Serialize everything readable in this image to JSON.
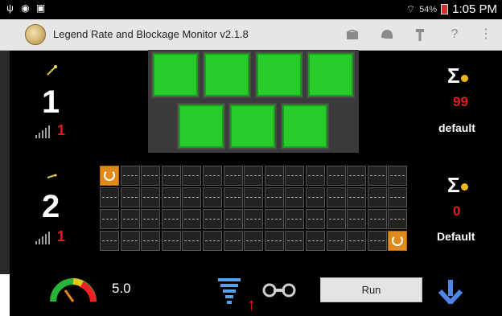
{
  "status_bar": {
    "left_icons": [
      "usb-icon",
      "location-icon",
      "image-icon"
    ],
    "wifi_icon": "wifi-icon",
    "battery_text": "54%",
    "time": "1:05 PM"
  },
  "app_bar": {
    "title": "Legend Rate and Blockage Monitor v2.1.8",
    "actions": [
      "seed-tray-icon",
      "helmet-icon",
      "tool-icon",
      "help-icon",
      "overflow-menu-icon"
    ]
  },
  "channels": [
    {
      "number": "1",
      "signal_value": "1",
      "sum_count": "99",
      "profile": "default"
    },
    {
      "number": "2",
      "signal_value": "1",
      "sum_count": "0",
      "profile": "Default"
    }
  ],
  "grid_channel1": {
    "rows": 2,
    "top_count": 4,
    "bottom_count": 3,
    "status_color": "#27cc2a"
  },
  "grid_channel2": {
    "rows": 4,
    "cols": 15,
    "highlighted": [
      [
        0,
        0
      ],
      [
        3,
        14
      ]
    ],
    "highlight_color": "#e08a1c"
  },
  "bottom": {
    "speed": "5.0",
    "run_label": "Run"
  },
  "colors": {
    "accent_red": "#e31c1c",
    "arrow_blue": "#4f86e6"
  }
}
